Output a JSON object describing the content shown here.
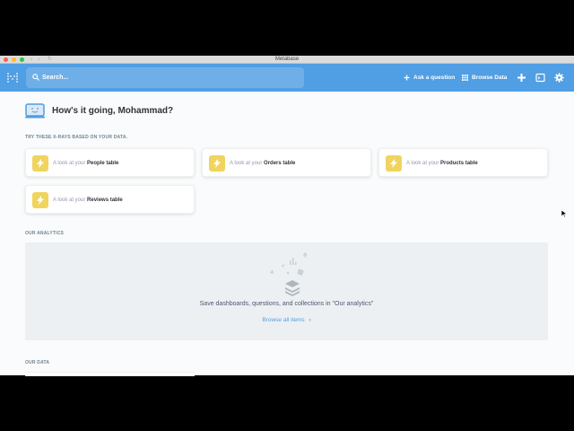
{
  "window": {
    "title": "Metabase"
  },
  "navbar": {
    "search_placeholder": "Search...",
    "ask_question_label": "Ask a question",
    "browse_data_label": "Browse Data"
  },
  "home": {
    "greeting": "How's it going, Mohammad?",
    "xrays_heading": "TRY THESE X-RAYS BASED ON YOUR DATA.",
    "xray_prefix": "A look at your",
    "xrays": [
      {
        "table": "People table"
      },
      {
        "table": "Orders table"
      },
      {
        "table": "Products table"
      },
      {
        "table": "Reviews table"
      }
    ],
    "analytics_heading": "OUR ANALYTICS",
    "analytics_empty": "Save dashboards, questions, and collections in \"Our analytics\"",
    "browse_all_label": "Browse all items",
    "our_data_heading": "OUR DATA"
  },
  "colors": {
    "brand": "#509ee3",
    "xray_bolt": "#f0d45e",
    "background": "#f9fbfc"
  }
}
